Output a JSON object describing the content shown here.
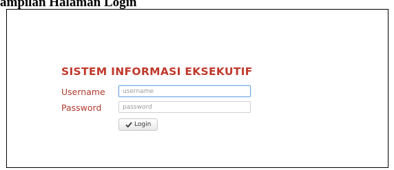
{
  "caption": "ampilan Halaman Login",
  "login": {
    "title": "SISTEM INFORMASI EKSEKUTIF",
    "username_label": "Username",
    "username_placeholder": "username",
    "password_label": "Password",
    "password_placeholder": "password",
    "login_button": "Login",
    "button_icon": "check-icon"
  },
  "colors": {
    "title": "#c0392b",
    "label": "#b03a2e",
    "focus_border": "#77a7e0"
  }
}
